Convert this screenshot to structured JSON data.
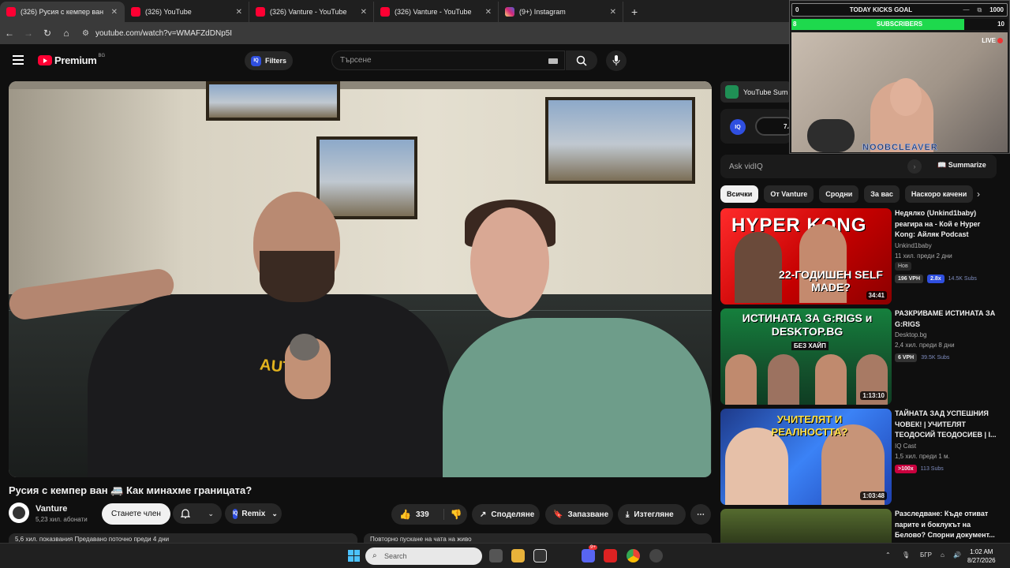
{
  "tabs": [
    {
      "title": "(326) Русия с кемпер ван",
      "active": true,
      "icon": "youtube-icon"
    },
    {
      "title": "(326) YouTube",
      "active": false,
      "icon": "youtube-icon"
    },
    {
      "title": "(326) Vanture - YouTube",
      "active": false,
      "icon": "youtube-icon"
    },
    {
      "title": "(326) Vanture - YouTube",
      "active": false,
      "icon": "youtube-icon"
    },
    {
      "title": "(9+) Instagram",
      "active": false,
      "icon": "instagram-icon"
    }
  ],
  "address": {
    "url": "youtube.com/watch?v=WMAFZdDNp5I"
  },
  "header": {
    "brand": "Premium",
    "region": "BG",
    "filters_label": "Filters",
    "search_placeholder": "Търсене"
  },
  "video": {
    "title": "Русия с кемпер ван 🚐 Как минахме границата?",
    "shirt_text": "AUTHE",
    "channel": "Vanture",
    "subscribers": "5,23 хил. абонати",
    "join_label": "Станете член",
    "remix_label": "Remix",
    "likes": "339",
    "share_label": "Споделяне",
    "save_label": "Запазване",
    "download_label": "Изтегляне",
    "description_meta": "5,6 хил. показвания  Предавано поточно преди 4 дни",
    "chat_replay": "Повторно пускане на чата на живо"
  },
  "side": {
    "summary_label": "YouTube Sum",
    "iq_value": "7.4",
    "ask_placeholder": "Ask vidIQ",
    "summarize_label": "Summarize",
    "chips": [
      "Всички",
      "От Vanture",
      "Сродни",
      "За вас",
      "Наскоро качени"
    ]
  },
  "recommendations": [
    {
      "title": "Недялко (Unkind1baby) реагира на - Кой е Hyper Kong: Айляк Podcast",
      "channel": "Unkind1baby",
      "meta": "11 хил.  преди 2 дни",
      "badge": "Нов",
      "duration": "34:41",
      "vph": "196 VPH",
      "mult": "2.8x",
      "subs": "14.5K Subs",
      "thumb_text": "22-ГОДИШЕН SELF MADE?",
      "thumb_top": "HYPER KONG"
    },
    {
      "title": "РАЗКРИВАМЕ ИСТИНАТА ЗА G:RIGS",
      "channel": "Desktop.bg",
      "meta": "2,4 хил.  преди 8 дни",
      "duration": "1:13:10",
      "vph": "6 VPH",
      "subs": "39.5K Subs",
      "thumb_text": "ИСТИНАТА ЗА G:RIGS и DESKTOP.BG",
      "thumb_sub": "БЕЗ ХАЙП"
    },
    {
      "title": "ТАЙНАТА ЗАД УСПЕШНИЯ ЧОВЕК! | УЧИТЕЛЯТ ТЕОДОСИЙ ТЕОДОСИЕВ | I...",
      "channel": "IQ Cast",
      "meta": "1,5 хил.  преди 1 м.",
      "duration": "1:03:48",
      "mult": ">100x",
      "subs": "113 Subs",
      "thumb_text": "УЧИТЕЛЯТ И РЕАЛНОСТТА?"
    },
    {
      "title": "Разследване: Къде отиват парите и боклукът на Белово? Спорни документ..."
    }
  ],
  "overlay": {
    "goal_start": "0",
    "goal_title": "TODAY KICKS GOAL",
    "goal_end": "1000",
    "subs_start": "8",
    "subs_label": "SUBSCRIBERS",
    "subs_end": "10",
    "subs_progress": 0.8,
    "live": "LIVE",
    "nickname": "NOOBCLEAVER"
  },
  "taskbar": {
    "search_placeholder": "Search",
    "lang": "БГР",
    "time": "1:02 AM",
    "date": "8/27/2026",
    "discord_badge": "9+"
  },
  "colors": {
    "accent": "#ff0033",
    "iq_blue": "#2f4fe0",
    "goal_green": "#1ed94d"
  }
}
